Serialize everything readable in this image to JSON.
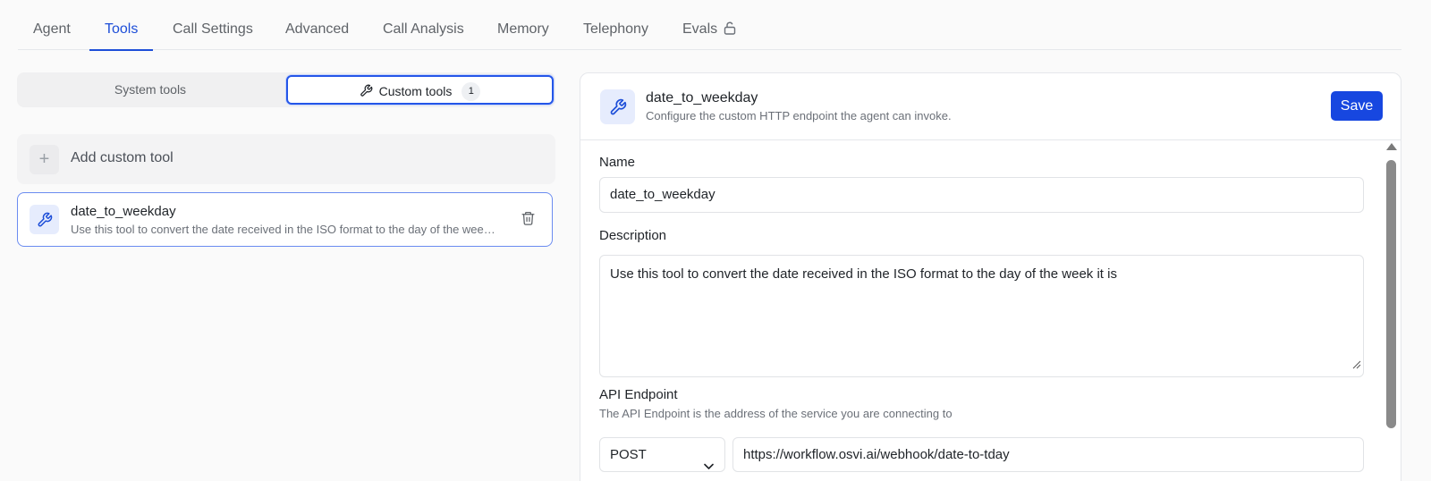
{
  "tabs": [
    {
      "label": "Agent"
    },
    {
      "label": "Tools"
    },
    {
      "label": "Call Settings"
    },
    {
      "label": "Advanced"
    },
    {
      "label": "Call Analysis"
    },
    {
      "label": "Memory"
    },
    {
      "label": "Telephony"
    },
    {
      "label": "Evals"
    }
  ],
  "active_tab": "Tools",
  "tool_switch": {
    "system_label": "System tools",
    "custom_label": "Custom tools",
    "custom_count": "1",
    "selected": "Custom tools"
  },
  "tool_list": {
    "add_label": "Add custom tool",
    "items": [
      {
        "name": "date_to_weekday",
        "description": "Use this tool to convert the date received in the ISO format to the day of the week it is"
      }
    ]
  },
  "editor": {
    "title": "date_to_weekday",
    "subtitle": "Configure the custom HTTP endpoint the agent can invoke.",
    "save_label": "Save",
    "name_label": "Name",
    "name_value": "date_to_weekday",
    "description_label": "Description",
    "description_value": "Use this tool to convert the date received in the ISO format to the day of the week it is",
    "endpoint_label": "API Endpoint",
    "endpoint_hint": "The API Endpoint is the address of the service you are connecting to",
    "method_value": "POST",
    "url_value": "https://workflow.osvi.ai/webhook/date-to-tday"
  },
  "colors": {
    "accent": "#1d4ed8",
    "save_button": "#1747e0"
  },
  "icons": {
    "tool": "wrench-icon",
    "lock": "lock-open-icon",
    "delete": "trash-icon",
    "add": "plus-icon"
  }
}
